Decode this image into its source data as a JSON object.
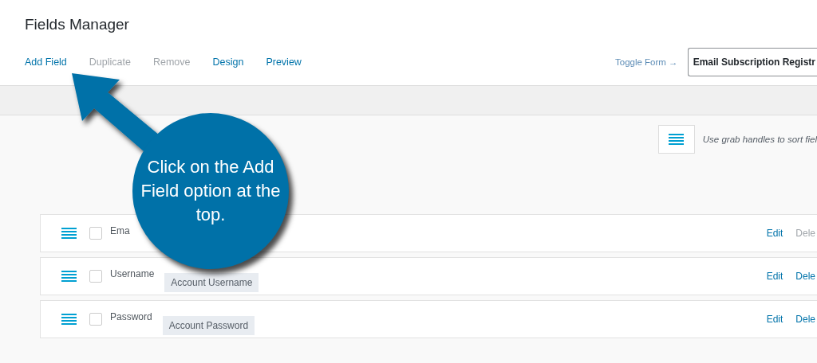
{
  "header": {
    "title": "Fields Manager"
  },
  "nav": [
    {
      "label": "Add Field",
      "disabled": false
    },
    {
      "label": "Duplicate",
      "disabled": true
    },
    {
      "label": "Remove",
      "disabled": true
    },
    {
      "label": "Design",
      "disabled": false
    },
    {
      "label": "Preview",
      "disabled": false
    }
  ],
  "toggle_form": {
    "label": "Toggle Form →",
    "value": "Email Subscription Registr"
  },
  "sort_hint": "Use grab handles to sort fiel",
  "rows": [
    {
      "label": "Ema",
      "checked": false,
      "edit": "Edit",
      "delete": "Dele",
      "delete_disabled": true
    },
    {
      "label": "Username",
      "tag": "Account Username",
      "checked": false,
      "edit": "Edit",
      "delete": "Dele",
      "delete_disabled": false
    },
    {
      "label": "Password",
      "tag": "Account Password",
      "checked": false,
      "edit": "Edit",
      "delete": "Dele",
      "delete_disabled": false
    }
  ],
  "callout": {
    "text": "Click on the Add Field option at the top."
  }
}
